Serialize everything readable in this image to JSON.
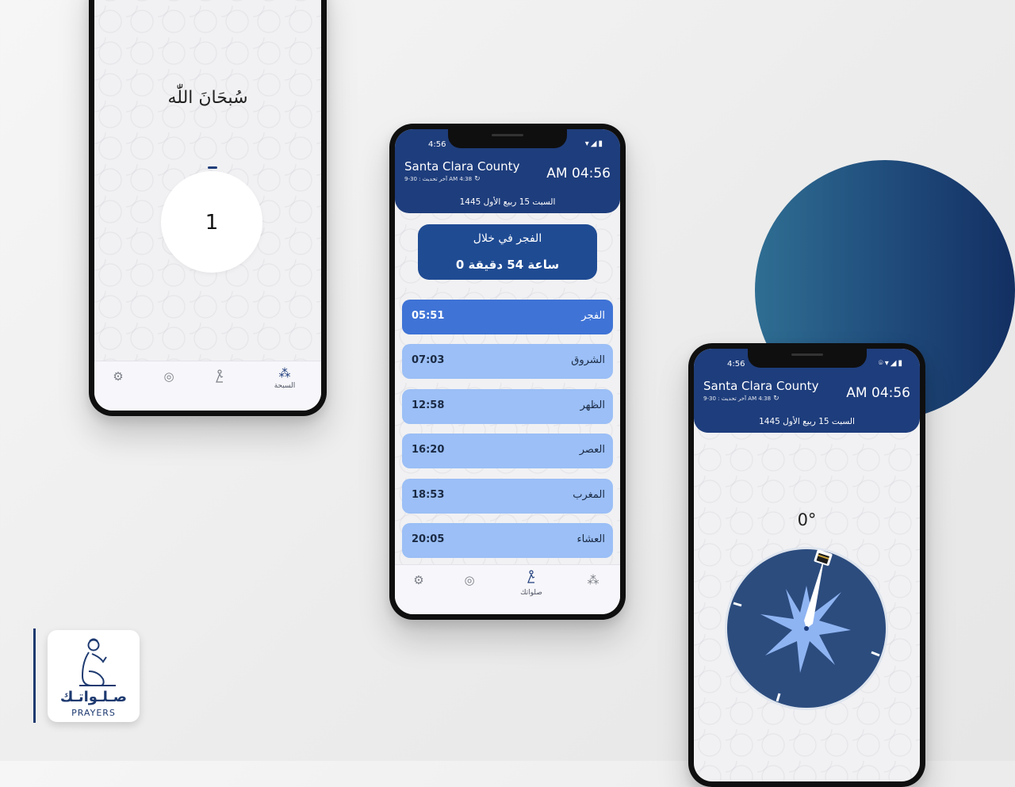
{
  "header": {
    "status_time": "4:56",
    "city": "Santa Clara County",
    "last_update": "آخر تحديث : 30-9 AM 4:38",
    "clock": "AM 04:56",
    "hijri_date": "السبت 15 ربيع الأول 1445"
  },
  "next_prayer": {
    "label": "الفجر في خلال",
    "remaining": "0 ساعة 54 دقيقة"
  },
  "prayers": [
    {
      "name": "الفجر",
      "time": "05:51",
      "active": true
    },
    {
      "name": "الشروق",
      "time": "07:03",
      "active": false
    },
    {
      "name": "الظهر",
      "time": "12:58",
      "active": false
    },
    {
      "name": "العصر",
      "time": "16:20",
      "active": false
    },
    {
      "name": "المغرب",
      "time": "18:53",
      "active": false
    },
    {
      "name": "العشاء",
      "time": "20:05",
      "active": false
    }
  ],
  "nav": {
    "prayers_label": "صلواتك",
    "tasbih_label": "السبحة",
    "icons": [
      "gear-icon",
      "compass-icon",
      "praying-person-icon",
      "prayer-beads-icon"
    ]
  },
  "tasbih": {
    "dhikr": "سُبحَانَ اللّٰه",
    "count": "1"
  },
  "qibla": {
    "degrees": "0°",
    "heading": 0
  },
  "logo": {
    "arabic": "صـلـواتـك",
    "english": "PRAYERS"
  },
  "colors": {
    "primary": "#1e3d7c",
    "active_row": "#3f73d6",
    "row": "#9bbff6",
    "compass_face": "#2c4c7e",
    "compass_star": "#8fb4f2"
  }
}
